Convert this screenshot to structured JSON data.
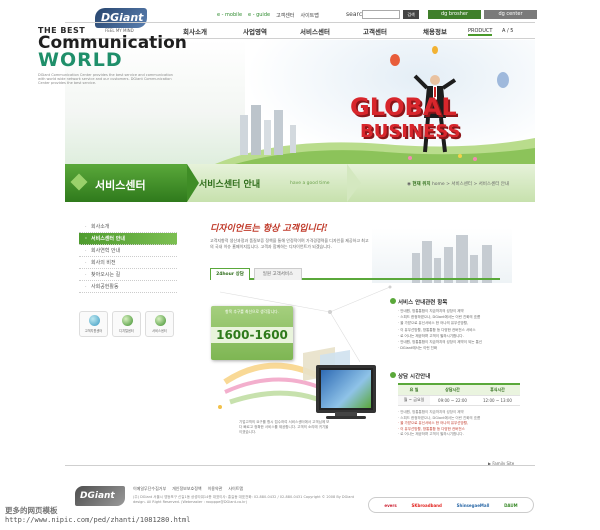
{
  "header": {
    "logo_text": "DGiant",
    "logo_sub": "FEEL MY MIND",
    "top_links": [
      "e - mobile",
      "e - guide",
      "고객센터",
      "사이트맵"
    ],
    "search_label": "search",
    "search_button": "검색",
    "btn_brochure": "dg brosher",
    "btn_center": "dg center",
    "nav": [
      "회사소개",
      "사업영역",
      "서비스센터",
      "고객센터",
      "채용정보"
    ],
    "product_label": "PRODUCT",
    "page_indicator": "A / 5"
  },
  "hero": {
    "line1": "THE BEST",
    "line2": "Communication",
    "line3": "WORLD",
    "desc": "DGiant Communication Center provides the best service and communication with world wide network service and our customers. DGiant Communication Center provides the best service.",
    "graphic_word1": "GLOBAL",
    "graphic_word2": "BUSINESS"
  },
  "section_bar": {
    "title": "서비스센터",
    "subtitle": "서비스센터 안내",
    "tagline": "have a good time",
    "breadcrumb_label": "현재 위치",
    "breadcrumb_path": "home > 서비스센터 > 서비스센터 안내"
  },
  "sidebar": {
    "items": [
      "회사소개",
      "서비스센터 안내",
      "회사연혁 안내",
      "회사의 비전",
      "찾아오시는 길",
      "사회공헌활동"
    ],
    "icons": [
      "고객지원센터",
      "디지털센터",
      "서비스센터"
    ]
  },
  "content": {
    "headline": "디자이언트는 항상 고객입니다!",
    "intro": "고객지향적 생산과정과 품질보증 정책을 통해 안정적이며 가격경쟁력을 디자인을 제공하고 최고의 국내 이슈 홈페이지입니다. 고객과 함께하는 디자이언트가 되겠습니다.",
    "tabs": [
      "24hour 상담",
      "일원 고객서비스"
    ],
    "card_caption": "항목 추구를 최선으로 생각합니다.",
    "phone": "1600-1600",
    "small_desc": "기업고객의 요구를 항시 접수하여 서비스센터에서 고객님께 보다 빠르고 정확한 서비스를 제공합니다. 고객의 소리에 귀기울이겠습니다."
  },
  "service": {
    "title": "서비스 안내관련 항목",
    "lines": [
      "· 안내원, 방통통합이 지금까지의 성장이 제약",
      "· 스피드 한정하였으나, DGiant에서는 이런 진화의 흐름",
      "· 을 가받으로 유신서비스 한 어나의 유무선망활,",
      "· 이 유무선망활, 방통통합 등 다양한 컨버전스 서비스",
      "· 로 어나는 제공하며 고객이 필하시기합니다.",
      "· 안내원, 방통통합이 지금까지의 성장이 제약이 되는 통신",
      "· DGiant에서는 이런 진화"
    ]
  },
  "hours": {
    "title": "상담 시간안내",
    "headers": [
      "요 일",
      "상담시간",
      "휴식시간"
    ],
    "day": "월 ~ 금요일",
    "time": "09:00 ~ 22:00",
    "break": "12:00 ~ 13:00"
  },
  "notes": [
    {
      "text": "· 안내원, 방통통합이 지금까지의 성장이 제약",
      "hl": false
    },
    {
      "text": "· 스피드 한정하였으나, DGiant에서는 이런 진화의 흐름",
      "hl": false
    },
    {
      "text": "· 을 가받으로 유신서비스 한 어나의 유무선망활,",
      "hl": true
    },
    {
      "text": "· 이 유무선망활, 방통통합 등 다양한 컨버전스",
      "hl": true
    },
    {
      "text": "· 로 어나는 제공하며 고객이 필하시기합니다.",
      "hl": false
    }
  ],
  "footer": {
    "family_label": "▶ Family Site",
    "logo_text": "DGiant",
    "links": [
      "이메일무단수집거부",
      "개인정보보호정책",
      "이용약관",
      "사이트맵"
    ],
    "address": "(주) DGiant 서울시 영등포구 신길1동 상성타워14층 대표이사: 홍길동 대표전화: 02-880-0432 / 02-880-0431 Copyright © 2008 By DGiant design. All Right Reserved. (Webmaster : roopppe@DGiant.co.kr)",
    "family_sites": [
      "evers",
      "SKbroadband",
      "ShinsegaeMall",
      "DAUM"
    ],
    "watermark": "更多的网页模板",
    "watermark_url": "http://www.nipic.com/ped/zhanti/1081280.html"
  },
  "colors": {
    "accent_green": "#3f8d26",
    "accent_red": "#d8262c",
    "navy": "#27456e"
  }
}
